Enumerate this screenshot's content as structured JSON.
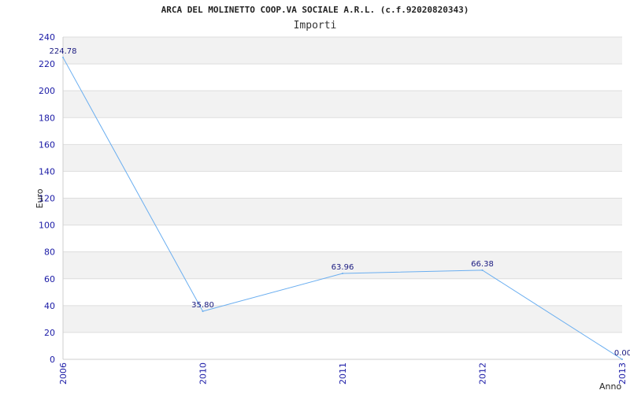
{
  "chart_data": {
    "type": "line",
    "title": "ARCA DEL MOLINETTO COOP.VA SOCIALE A.R.L. (c.f.92020820343)",
    "subtitle": "Importi",
    "xlabel": "Anno",
    "ylabel": "Euro",
    "categories": [
      "2006",
      "2010",
      "2011",
      "2012",
      "2013"
    ],
    "values": [
      224.78,
      35.8,
      63.96,
      66.38,
      0.0
    ],
    "value_labels": [
      "224.78",
      "35.80",
      "63.96",
      "66.38",
      "0.00"
    ],
    "ylim": [
      0,
      240
    ],
    "yticks": [
      "0",
      "20",
      "40",
      "60",
      "80",
      "100",
      "120",
      "140",
      "160",
      "180",
      "200",
      "220",
      "240"
    ],
    "grid": true,
    "line_color": "#6aaef0",
    "band_color": "#f2f2f2"
  }
}
